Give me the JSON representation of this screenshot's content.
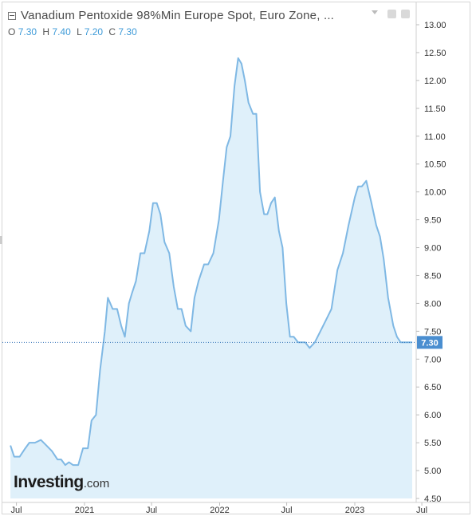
{
  "header": {
    "title": "Vanadium Pentoxide 98%Min Europe Spot, Euro Zone, ...",
    "ohlc": [
      {
        "label": "O",
        "value": "7.30"
      },
      {
        "label": "H",
        "value": "7.40"
      },
      {
        "label": "L",
        "value": "7.20"
      },
      {
        "label": "C",
        "value": "7.30"
      }
    ]
  },
  "logo": {
    "main": "Investing",
    "suffix": ".com"
  },
  "colors": {
    "line": "#7fb8e4",
    "fill": "#dff0fa",
    "price_tag": "#4a8ed0",
    "ref_line": "#2f6fb5"
  },
  "chart_data": {
    "type": "area",
    "title": "Vanadium Pentoxide 98%Min Europe Spot, Euro Zone, ...",
    "xlabel": "",
    "ylabel": "",
    "ylim": [
      4.45,
      13.0
    ],
    "y_ticks": [
      "13.00",
      "12.50",
      "12.00",
      "11.50",
      "11.00",
      "10.50",
      "10.00",
      "9.50",
      "9.00",
      "8.50",
      "8.00",
      "7.50",
      "7.00",
      "6.50",
      "6.00",
      "5.50",
      "5.00",
      "4.50"
    ],
    "x_ticks": [
      {
        "label": "Jul",
        "date": "2020-07-01"
      },
      {
        "label": "2021",
        "date": "2021-01-01"
      },
      {
        "label": "Jul",
        "date": "2021-07-01"
      },
      {
        "label": "2022",
        "date": "2022-01-01"
      },
      {
        "label": "Jul",
        "date": "2022-07-01"
      },
      {
        "label": "2023",
        "date": "2023-01-01"
      },
      {
        "label": "Jul",
        "date": "2023-07-01"
      }
    ],
    "last_value": "7.30",
    "series": [
      {
        "x": [
          "2020-06-15",
          "2020-06-25",
          "2020-07-10",
          "2020-07-25",
          "2020-08-05",
          "2020-08-20",
          "2020-09-05",
          "2020-09-20",
          "2020-10-05",
          "2020-10-20",
          "2020-10-30",
          "2020-11-10",
          "2020-11-20",
          "2020-12-01",
          "2020-12-15",
          "2020-12-28",
          "2021-01-10",
          "2021-01-20",
          "2021-02-01",
          "2021-02-12",
          "2021-02-25",
          "2021-03-05",
          "2021-03-18",
          "2021-03-30",
          "2021-04-10",
          "2021-04-20",
          "2021-05-01",
          "2021-05-10",
          "2021-05-20",
          "2021-06-01",
          "2021-06-12",
          "2021-06-25",
          "2021-07-05",
          "2021-07-15",
          "2021-07-25",
          "2021-08-05",
          "2021-08-18",
          "2021-08-30",
          "2021-09-10",
          "2021-09-20",
          "2021-10-01",
          "2021-10-15",
          "2021-10-25",
          "2021-11-05",
          "2021-11-20",
          "2021-12-01",
          "2021-12-15",
          "2021-12-30",
          "2022-01-10",
          "2022-01-20",
          "2022-01-30",
          "2022-02-10",
          "2022-02-20",
          "2022-03-01",
          "2022-03-10",
          "2022-03-20",
          "2022-04-01",
          "2022-04-10",
          "2022-04-20",
          "2022-05-01",
          "2022-05-10",
          "2022-05-20",
          "2022-05-30",
          "2022-06-10",
          "2022-06-20",
          "2022-06-30",
          "2022-07-10",
          "2022-07-20",
          "2022-08-01",
          "2022-08-20",
          "2022-09-01",
          "2022-09-15",
          "2022-09-30",
          "2022-10-15",
          "2022-10-30",
          "2022-11-15",
          "2022-11-30",
          "2022-12-15",
          "2023-01-01",
          "2023-01-10",
          "2023-01-20",
          "2023-02-01",
          "2023-02-15",
          "2023-02-28",
          "2023-03-10",
          "2023-03-20",
          "2023-04-01",
          "2023-04-15",
          "2023-04-25",
          "2023-05-05",
          "2023-05-15",
          "2023-05-25",
          "2023-06-05"
        ],
        "y": [
          5.45,
          5.25,
          5.25,
          5.4,
          5.5,
          5.5,
          5.55,
          5.45,
          5.35,
          5.2,
          5.2,
          5.1,
          5.15,
          5.1,
          5.1,
          5.4,
          5.4,
          5.9,
          6.0,
          6.8,
          7.5,
          8.1,
          7.9,
          7.9,
          7.6,
          7.4,
          8.0,
          8.2,
          8.4,
          8.9,
          8.9,
          9.3,
          9.8,
          9.8,
          9.6,
          9.1,
          8.9,
          8.3,
          7.9,
          7.9,
          7.6,
          7.5,
          8.1,
          8.4,
          8.7,
          8.7,
          8.9,
          9.5,
          10.2,
          10.8,
          11.0,
          11.9,
          12.4,
          12.3,
          12.0,
          11.6,
          11.4,
          11.4,
          10.0,
          9.6,
          9.6,
          9.8,
          9.9,
          9.3,
          9.0,
          8.0,
          7.4,
          7.4,
          7.3,
          7.3,
          7.2,
          7.3,
          7.5,
          7.7,
          7.9,
          8.6,
          8.9,
          9.4,
          9.9,
          10.1,
          10.1,
          10.2,
          9.8,
          9.4,
          9.2,
          8.8,
          8.1,
          7.6,
          7.4,
          7.3,
          7.3,
          7.3,
          7.3
        ]
      }
    ]
  }
}
